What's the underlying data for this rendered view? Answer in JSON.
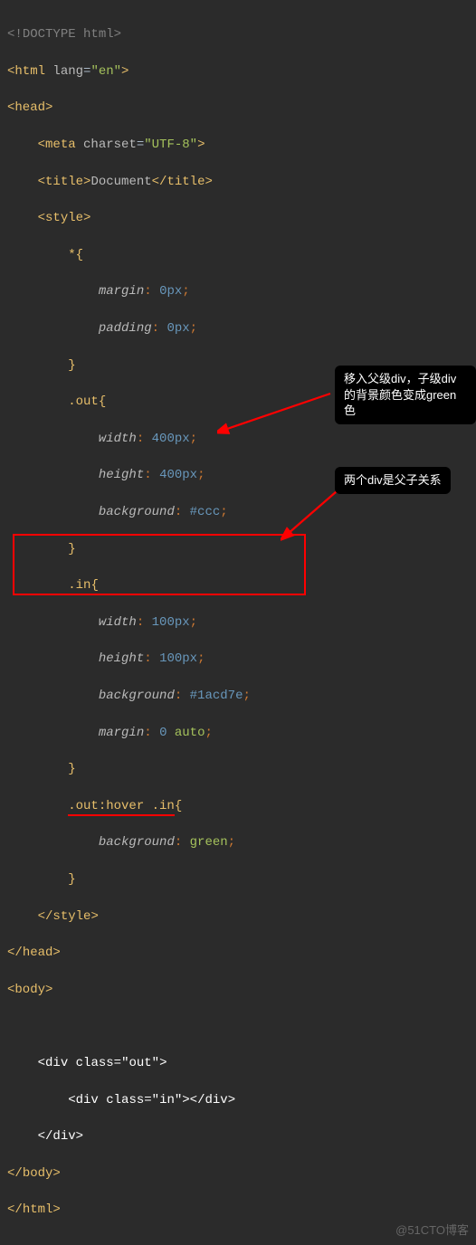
{
  "code": {
    "doctype_open": "<!",
    "doctype_kw": "DOCTYPE",
    "doctype_val": "html",
    "doctype_close": ">",
    "html_tag": "html",
    "lang_attr": "lang",
    "lang_val": "\"en\"",
    "head_tag": "head",
    "meta_tag": "meta",
    "charset_attr": "charset",
    "charset_val": "\"UTF-8\"",
    "title_tag": "title",
    "title_text": "Document",
    "style_tag": "style",
    "sel_star": "*",
    "prop_margin": "margin",
    "val_0px": "0px",
    "prop_padding": "padding",
    "sel_out": ".out",
    "prop_width": "width",
    "val_400px": "400px",
    "prop_height": "height",
    "prop_background": "background",
    "val_ccc": "#ccc",
    "sel_in": ".in",
    "val_100px": "100px",
    "val_1acd7e": "#1acd7e",
    "val_0": "0",
    "val_auto": "auto",
    "sel_hover": ".out:hover .in",
    "val_green": "green",
    "body_tag": "body",
    "div_tag": "div",
    "class_attr": "class",
    "class_out": "\"out\"",
    "class_in": "\"in\""
  },
  "annotations": {
    "a1": "移入父级div，子级div的背景颜色变成green色",
    "a2": "两个div是父子关系"
  },
  "watermark": "@51CTO博客",
  "chart_data": {
    "type": "code-screenshot",
    "language": "html+css",
    "highlighted_selector": ".out:hover .in",
    "boxed_region_lines": [
      "<div class=\"out\">",
      "    <div class=\"in\"></div>",
      "</div>"
    ],
    "annotations": [
      {
        "text": "移入父级div，子级div的背景颜色变成green色",
        "points_to": ".out:hover .in"
      },
      {
        "text": "两个div是父子关系",
        "points_to": "div.out > div.in markup"
      }
    ]
  }
}
